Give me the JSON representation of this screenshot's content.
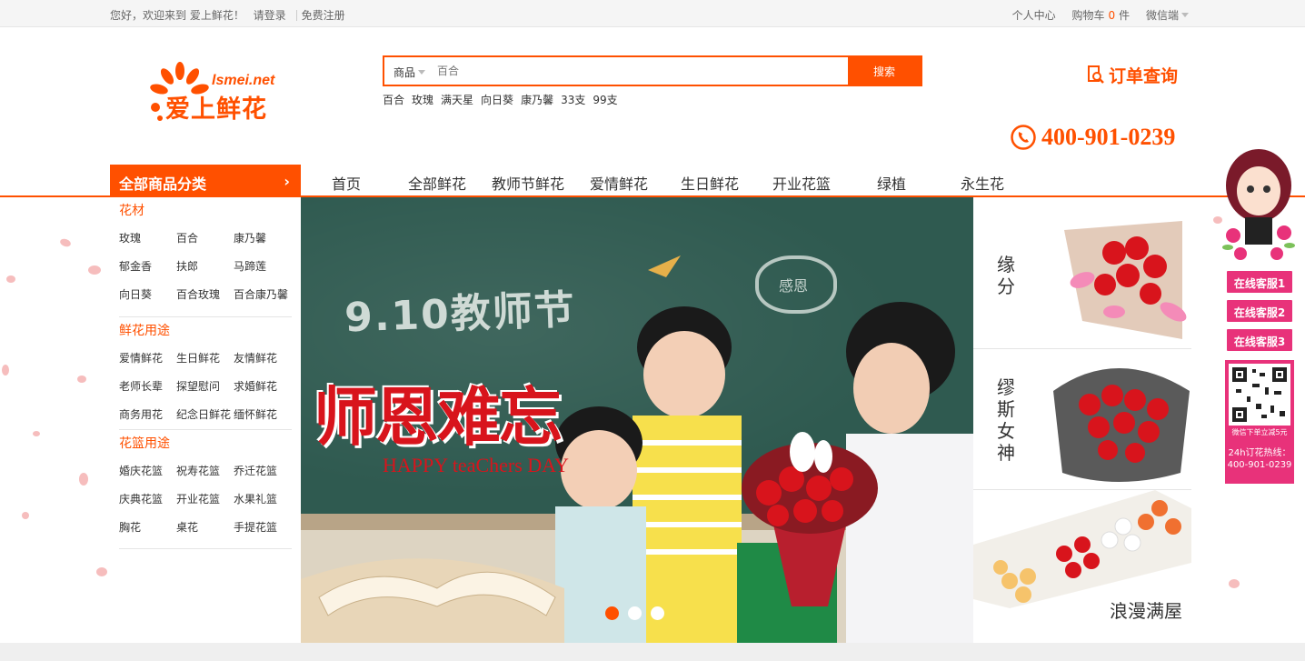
{
  "topbar": {
    "welcome": "您好，欢迎来到 爱上鲜花！",
    "login": "请登录",
    "register": "免费注册",
    "user_center": "个人中心",
    "cart_label": "购物车",
    "cart_count": "0",
    "cart_unit": "件",
    "wechat": "微信端"
  },
  "logo": {
    "en": "lsmei.net",
    "cn": "爱上鲜花"
  },
  "search": {
    "category": "商品",
    "placeholder": "百合",
    "button": "搜索",
    "hot": [
      "百合",
      "玫瑰",
      "满天星",
      "向日葵",
      "康乃馨",
      "33支",
      "99支"
    ]
  },
  "order_query": "订单查询",
  "phone": "400-901-0239",
  "all_categories": "全部商品分类",
  "nav": [
    "首页",
    "全部鲜花",
    "教师节鲜花",
    "爱情鲜花",
    "生日鲜花",
    "开业花篮",
    "绿植",
    "永生花"
  ],
  "sidebar": [
    {
      "title": "花材",
      "rows": [
        [
          "玫瑰",
          "百合",
          "康乃馨"
        ],
        [
          "郁金香",
          "扶郎",
          "马蹄莲"
        ],
        [
          "向日葵",
          "百合玫瑰",
          "百合康乃馨"
        ]
      ]
    },
    {
      "title": "鲜花用途",
      "rows": [
        [
          "爱情鲜花",
          "生日鲜花",
          "友情鲜花"
        ],
        [
          "老师长辈",
          "探望慰问",
          "求婚鲜花"
        ],
        [
          "商务用花",
          "纪念日鲜花",
          "缅怀鲜花"
        ]
      ]
    },
    {
      "title": "花篮用途",
      "rows": [
        [
          "婚庆花篮",
          "祝寿花篮",
          "乔迁花篮"
        ],
        [
          "庆典花篮",
          "开业花篮",
          "水果礼篮"
        ],
        [
          "胸花",
          "桌花",
          "手提花篮"
        ]
      ]
    }
  ],
  "banner": {
    "chalk_text": "9.10教师节",
    "bubble_text": "感恩",
    "title": "师恩难忘",
    "subtitle": "HAPPY teaChers DAY",
    "active_slide": 1,
    "slides": 3
  },
  "promos": [
    {
      "label": "缘分"
    },
    {
      "label": "缪斯女神"
    },
    {
      "label": "浪漫满屋"
    }
  ],
  "float": {
    "consult": [
      "在线客服1",
      "在线客服2",
      "在线客服3"
    ],
    "qr_note": "微信下单立减5元",
    "hotline_label": "24h订花热线：",
    "hotline": "400-901-0239"
  },
  "colors": {
    "accent": "#ff5000",
    "float_pink": "#e8327a",
    "title_red": "#d8141c"
  }
}
